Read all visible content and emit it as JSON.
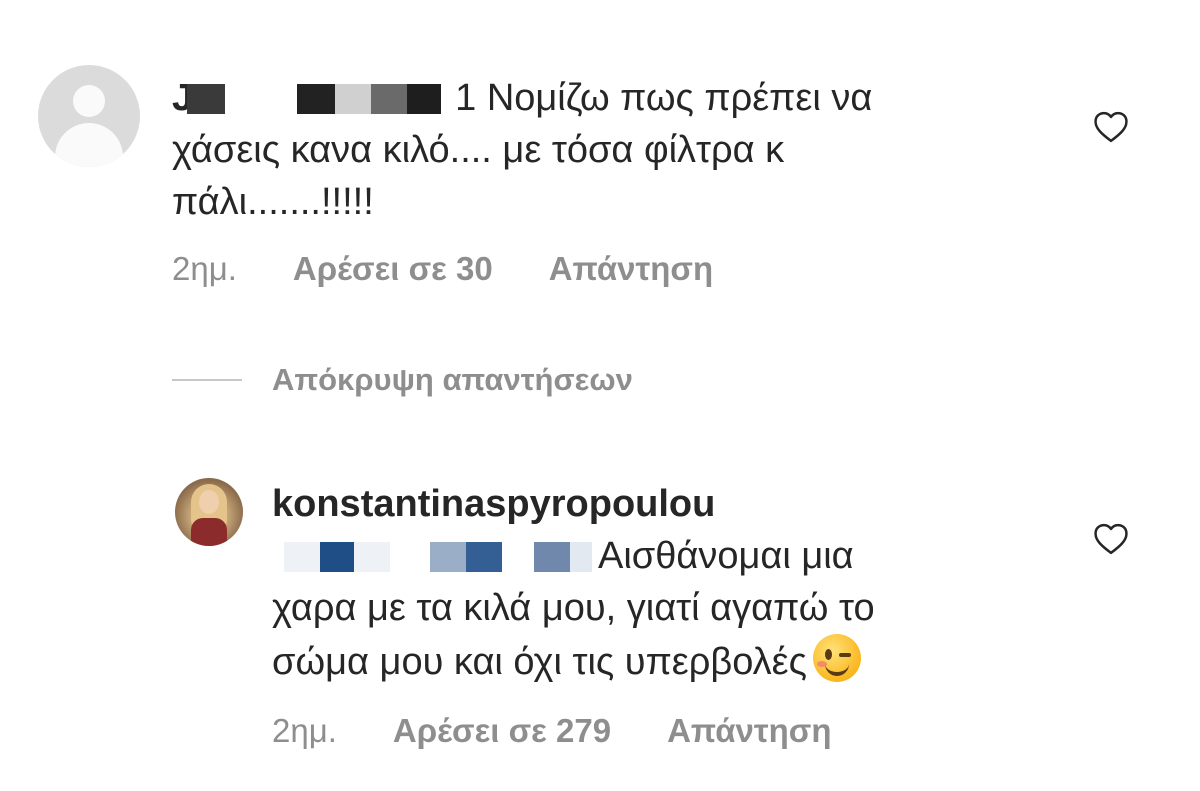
{
  "comment1": {
    "username_fragment": "J",
    "text_line1": "1 Νομίζω πως πρέπει να",
    "text_line2": "χάσεις κανα κιλό.... με τόσα φίλτρα κ",
    "text_line3": "πάλι.......!!!!!",
    "time": "2ημ.",
    "likes": "Αρέσει σε 30",
    "reply": "Απάντηση"
  },
  "hide_replies": {
    "label": "Απόκρυψη απαντήσεων"
  },
  "comment2": {
    "username": "konstantinaspyropoulou",
    "text_line1": "Αισθάνομαι μια",
    "text_line2": "χαρα με τα κιλά μου, γιατί αγαπώ το",
    "text_line3": "σώμα μου και όχι τις υπερβολές",
    "emoji": "winking-face-emoji",
    "time": "2ημ.",
    "likes": "Αρέσει σε 279",
    "reply": "Απάντηση"
  },
  "icons": {
    "heart": "heart-outline-icon",
    "default_avatar": "default-user-icon"
  },
  "colors": {
    "text": "#262626",
    "meta": "#8e8e8e",
    "avatar_bg": "#dbdbdb"
  }
}
